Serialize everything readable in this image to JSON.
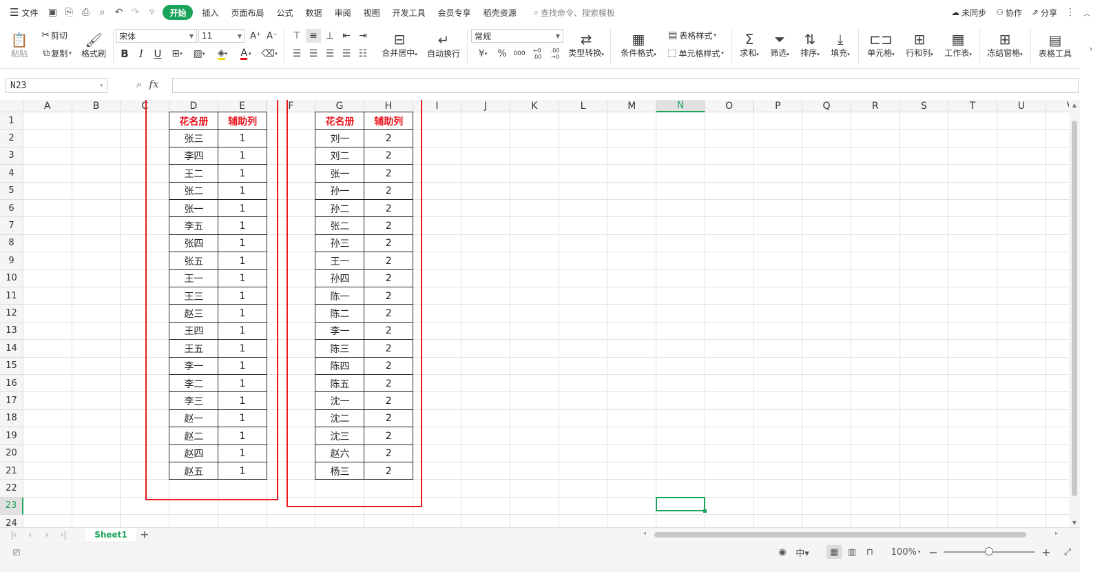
{
  "menu": {
    "file_label": "文件",
    "tabs": [
      "开始",
      "插入",
      "页面布局",
      "公式",
      "数据",
      "审阅",
      "视图",
      "开发工具",
      "会员专享",
      "稻壳资源"
    ],
    "active_tab": "开始",
    "search_placeholder": "查找命令、搜索模板",
    "right_items": [
      "未同步",
      "协作",
      "分享"
    ]
  },
  "ribbon": {
    "paste": "粘贴",
    "cut": "剪切",
    "copy": "复制",
    "format_painter": "格式刷",
    "font_name": "宋体",
    "font_size": "11",
    "number_format": "常规",
    "merge_center": "合并居中",
    "wrap_text": "自动换行",
    "type_convert": "类型转换",
    "conditional_format": "条件格式",
    "table_style": "表格样式",
    "cell_style": "单元格样式",
    "sum": "求和",
    "filter": "筛选",
    "sort": "排序",
    "fill": "填充",
    "cell": "单元格",
    "row_col": "行和列",
    "worksheet": "工作表",
    "freeze": "冻结窗格",
    "table_tools": "表格工具",
    "bold": "B",
    "italic": "I",
    "underline": "U",
    "font_color": "A",
    "currency": "¥",
    "percent": "%",
    "thousands": "000",
    "inc_decimal": "←0 .00",
    "dec_decimal": ".00 →0",
    "increase_font": "A⁺",
    "decrease_font": "A⁻"
  },
  "formula_bar": {
    "name_box": "N23",
    "fx_label": "fx",
    "formula": ""
  },
  "columns": [
    "A",
    "B",
    "C",
    "D",
    "E",
    "F",
    "G",
    "H",
    "I",
    "J",
    "K",
    "L",
    "M",
    "N",
    "O",
    "P",
    "Q",
    "R",
    "S",
    "T",
    "U",
    "V"
  ],
  "rows": [
    "1",
    "2",
    "3",
    "4",
    "5",
    "6",
    "7",
    "8",
    "9",
    "10",
    "11",
    "12",
    "13",
    "14",
    "15",
    "16",
    "17",
    "18",
    "19",
    "20",
    "21",
    "22",
    "23",
    "24"
  ],
  "selected_column": "N",
  "selected_row": "23",
  "table_left": {
    "headers": [
      "花名册",
      "辅助列"
    ],
    "names": [
      "张三",
      "李四",
      "王二",
      "张二",
      "张一",
      "李五",
      "张四",
      "张五",
      "王一",
      "王三",
      "赵三",
      "王四",
      "王五",
      "李一",
      "李二",
      "李三",
      "赵一",
      "赵二",
      "赵四",
      "赵五"
    ],
    "aux": [
      "1",
      "1",
      "1",
      "1",
      "1",
      "1",
      "1",
      "1",
      "1",
      "1",
      "1",
      "1",
      "1",
      "1",
      "1",
      "1",
      "1",
      "1",
      "1",
      "1"
    ]
  },
  "table_right": {
    "headers": [
      "花名册",
      "辅助列"
    ],
    "names": [
      "刘一",
      "刘二",
      "张一",
      "孙一",
      "孙二",
      "张二",
      "孙三",
      "王一",
      "孙四",
      "陈一",
      "陈二",
      "李一",
      "陈三",
      "陈四",
      "陈五",
      "沈一",
      "沈二",
      "沈三",
      "赵六",
      "杨三"
    ],
    "aux": [
      "2",
      "2",
      "2",
      "2",
      "2",
      "2",
      "2",
      "2",
      "2",
      "2",
      "2",
      "2",
      "2",
      "2",
      "2",
      "2",
      "2",
      "2",
      "2",
      "2"
    ]
  },
  "colors": {
    "accent": "#1aa35a",
    "header_text": "#e8141e",
    "red_box": "#e81818"
  },
  "sheet_tabs": [
    "Sheet1"
  ],
  "status": {
    "zoom": "100%"
  }
}
